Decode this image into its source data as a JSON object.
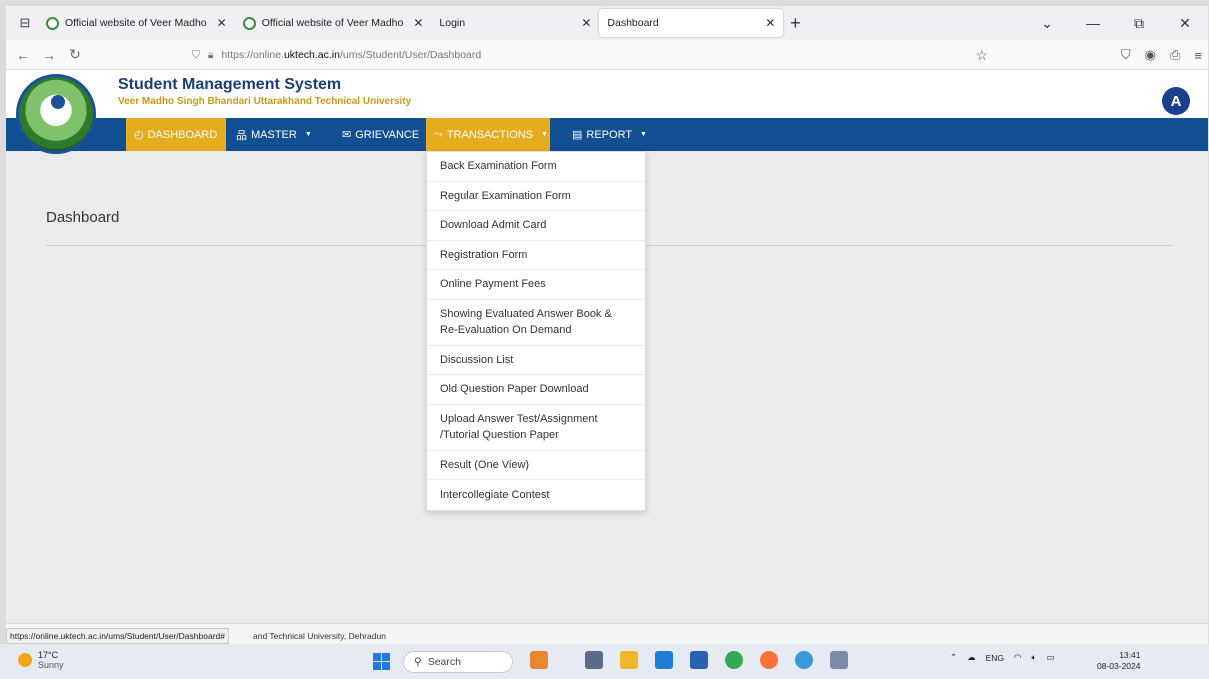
{
  "browser": {
    "tabs": [
      {
        "label": "Official website of Veer Madho"
      },
      {
        "label": "Official website of Veer Madho"
      },
      {
        "label": "Login"
      },
      {
        "label": "Dashboard"
      }
    ],
    "url_prefix": "https://online.",
    "url_domain": "uktech.ac.in",
    "url_path": "/ums/Student/User/Dashboard",
    "status_url": "https://online.uktech.ac.in/ums/Student/User/Dashboard#"
  },
  "app": {
    "title": "Student Management System",
    "subtitle": "Veer Madho Singh Bhandari Uttarakhand Technical University",
    "avatar_letter": "A"
  },
  "menu": {
    "dashboard": "DASHBOARD",
    "master": "MASTER",
    "grievance": "GRIEVANCE",
    "transactions": "TRANSACTIONS",
    "report": "REPORT"
  },
  "page": {
    "title": "Dashboard"
  },
  "dropdown": {
    "items": [
      "Back Examination Form",
      "Regular Examination Form",
      "Download Admit Card",
      "Registration Form",
      "Online Payment Fees",
      "Showing Evaluated Answer Book & Re-Evaluation On Demand",
      "Discussion List",
      "Old Question Paper Download",
      "Upload Answer Test/Assignment /Tutorial Question Paper",
      "Result (One View)",
      "Intercollegiate Contest"
    ]
  },
  "footer": {
    "text": "and Technical University, Dehradun"
  },
  "taskbar": {
    "temp": "17°C",
    "weather": "Sunny",
    "search_placeholder": "Search",
    "lang": "ENG",
    "time": "13:41",
    "date": "08-03-2024"
  },
  "colors": {
    "menu_bg": "#114f93",
    "menu_highlight": "#e5ac1d",
    "title": "#1b3f7a",
    "subtitle": "#c89a17"
  }
}
